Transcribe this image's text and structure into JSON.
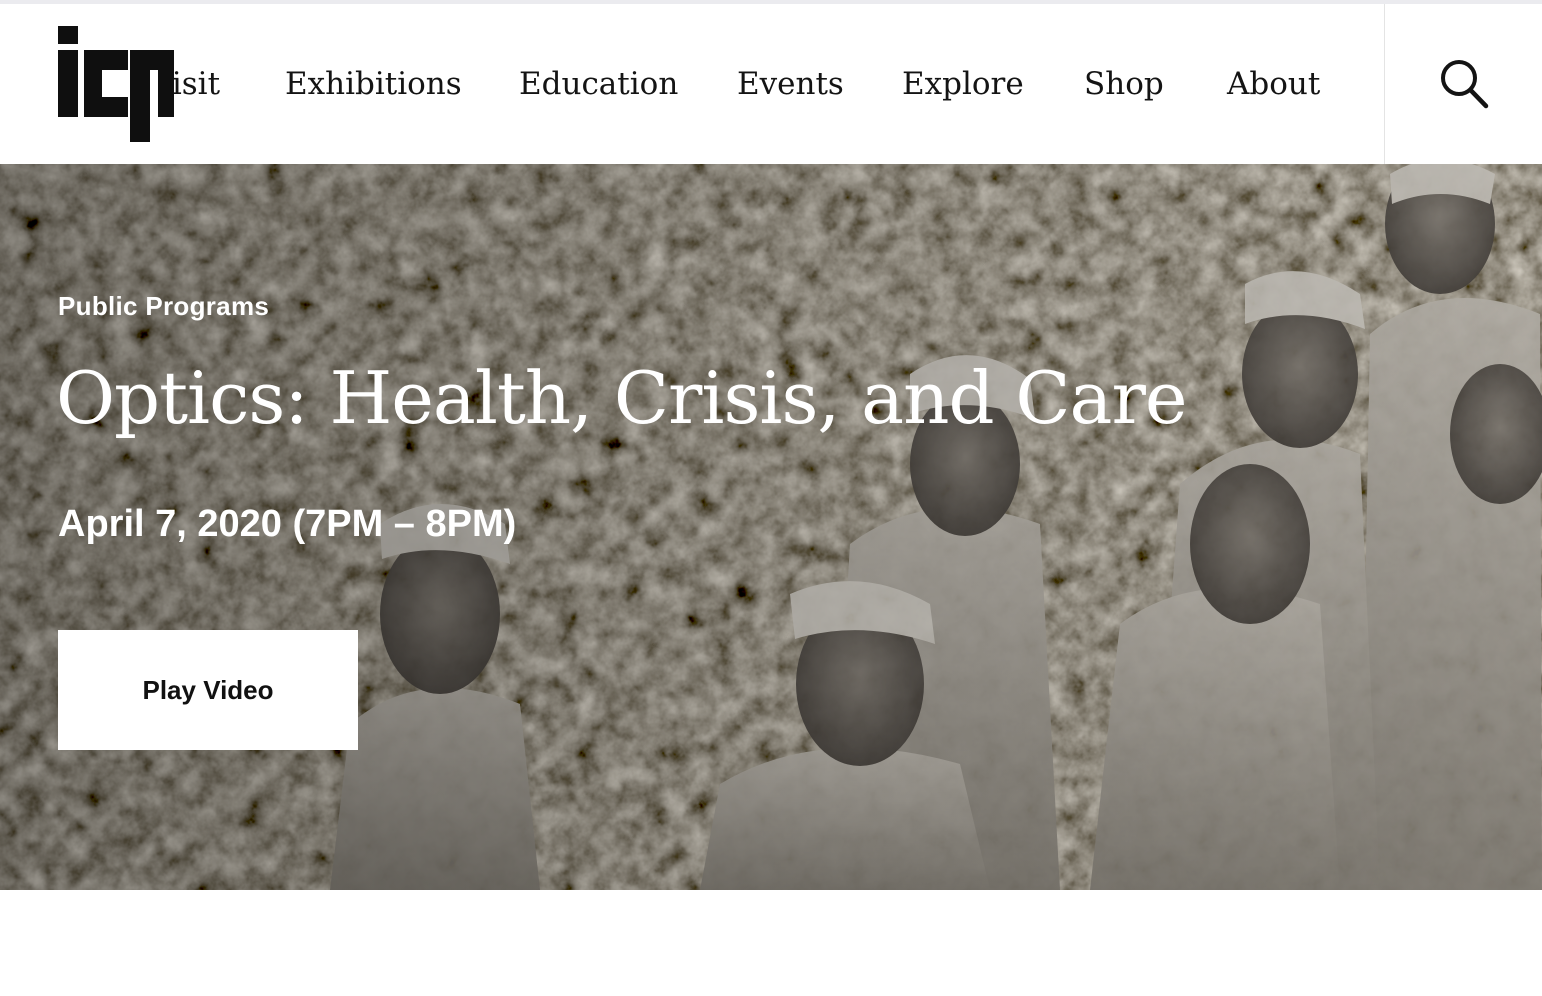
{
  "header": {
    "logo_text": "icp",
    "nav": [
      {
        "label": "Visit"
      },
      {
        "label": "Exhibitions"
      },
      {
        "label": "Education"
      },
      {
        "label": "Events"
      },
      {
        "label": "Explore"
      },
      {
        "label": "Shop"
      },
      {
        "label": "About"
      }
    ],
    "search_icon": "search-icon"
  },
  "hero": {
    "eyebrow": "Public Programs",
    "title": "Optics: Health, Crisis, and Care",
    "date": "April 7, 2020 (7PM – 8PM)",
    "play_button_label": "Play Video",
    "image_description_icon": "photo-nurses-walking-through-rubble"
  },
  "colors": {
    "text_dark": "#141414",
    "hero_text": "#ffffff",
    "button_bg": "#ffffff",
    "divider": "#e4e4e4"
  }
}
